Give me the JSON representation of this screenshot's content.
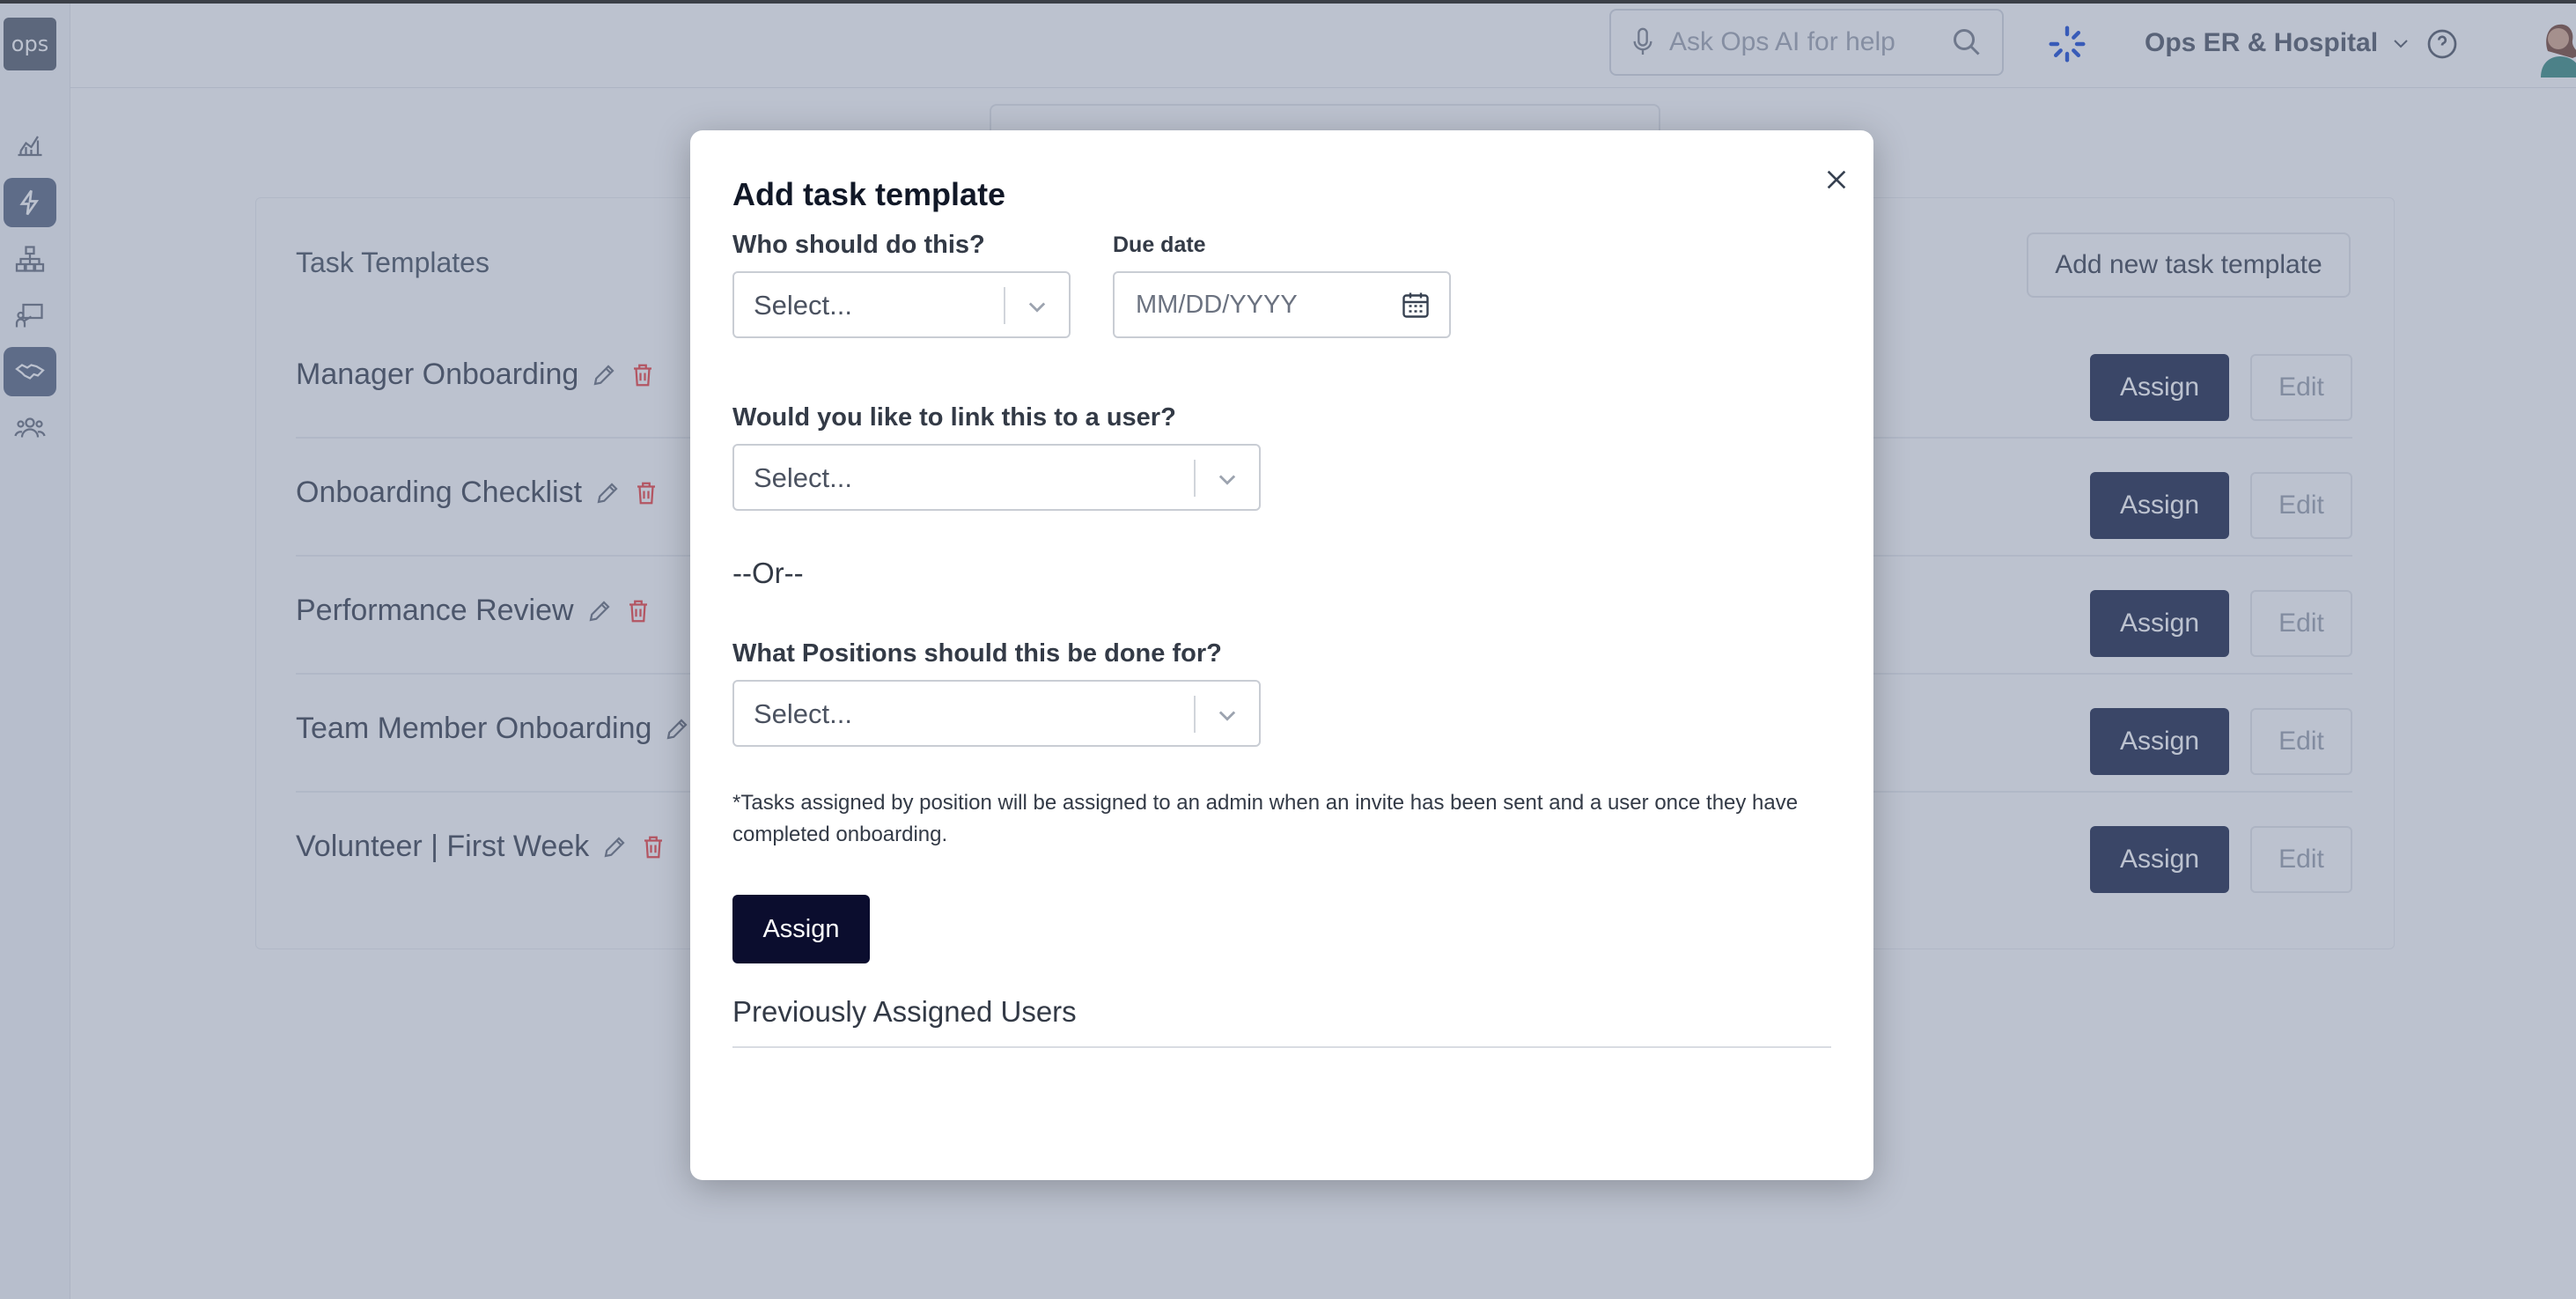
{
  "app": {
    "logo_text": "ops",
    "search_placeholder": "Ask Ops AI for help",
    "org_name": "Ops ER & Hospital",
    "sidebar_icons": [
      "chart-icon",
      "lightning-icon",
      "org-chart-icon",
      "training-icon",
      "handshake-icon",
      "team-icon"
    ],
    "active_sidebar_icon": "lightning-icon"
  },
  "page": {
    "card_title": "Task Templates",
    "add_new_label": "Add new task template",
    "assign_label": "Assign",
    "edit_label": "Edit",
    "rows": [
      {
        "name": "Manager Onboarding"
      },
      {
        "name": "Onboarding Checklist"
      },
      {
        "name": "Performance Review"
      },
      {
        "name": "Team Member Onboarding"
      },
      {
        "name": "Volunteer | First Week"
      }
    ]
  },
  "modal": {
    "title": "Add task template",
    "who_label": "Who should do this?",
    "who_placeholder": "Select...",
    "due_label": "Due date",
    "due_placeholder": "MM/DD/YYYY",
    "link_label": "Would you like to link this to a user?",
    "link_placeholder": "Select...",
    "or_text": "--Or--",
    "positions_label": "What Positions should this be done for?",
    "positions_placeholder": "Select...",
    "note": "*Tasks assigned by position will be assigned to an admin when an invite has been sent and a user once they have completed onboarding.",
    "assign_label": "Assign",
    "previously_assigned_label": "Previously Assigned Users"
  },
  "colors": {
    "primary": "#0b0d2e",
    "overlay": "#5f6e8c",
    "delete_red": "#ef4444"
  }
}
